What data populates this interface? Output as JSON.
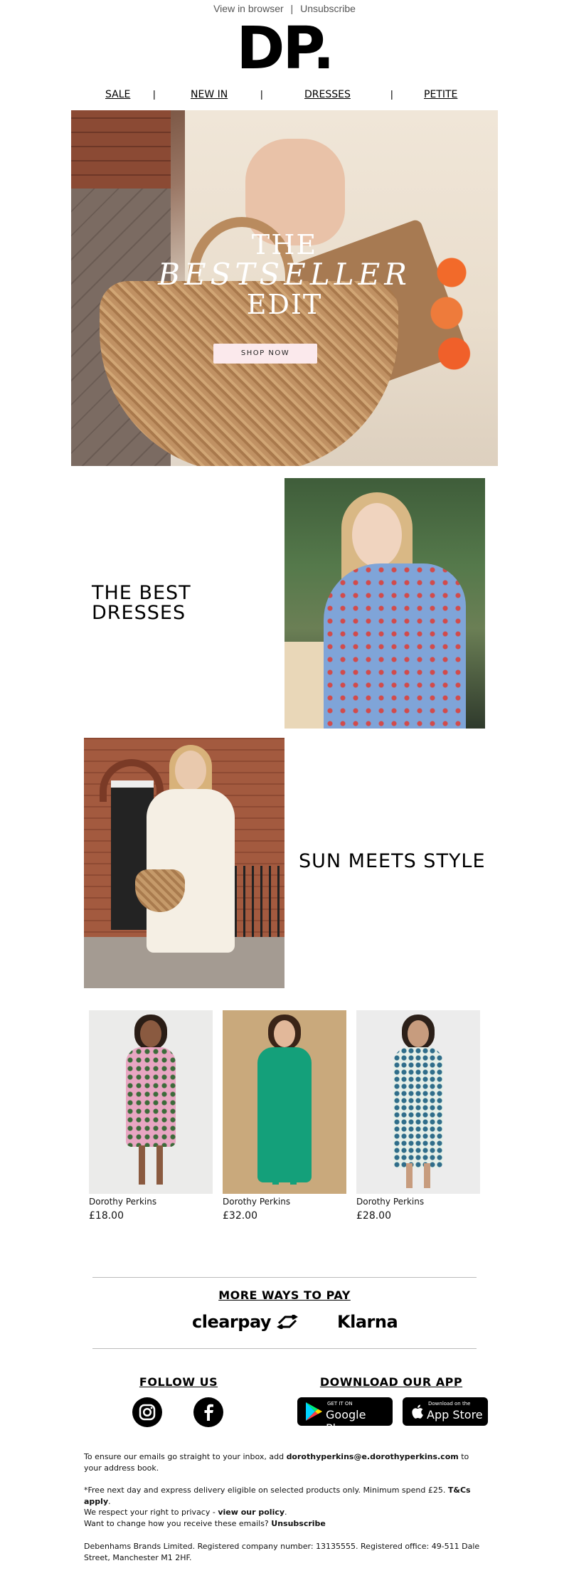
{
  "header": {
    "view_in_browser": "View in browser",
    "separator": "|",
    "unsubscribe": "Unsubscribe",
    "logo": "DP."
  },
  "nav": {
    "items": [
      "SALE",
      "NEW IN",
      "DRESSES",
      "PETITE"
    ],
    "separator": "|"
  },
  "hero": {
    "line1": "THE",
    "line2": "BESTSELLER",
    "line3": "EDIT",
    "cta": "SHOP NOW"
  },
  "features": {
    "block1_title_line1": "THE BEST",
    "block1_title_line2": "DRESSES",
    "block2_title": "SUN MEETS STYLE"
  },
  "products": [
    {
      "brand": "Dorothy Perkins",
      "price": "£18.00"
    },
    {
      "brand": "Dorothy Perkins",
      "price": "£32.00"
    },
    {
      "brand": "Dorothy Perkins",
      "price": "£28.00"
    }
  ],
  "payment": {
    "title": "MORE WAYS TO PAY",
    "clearpay": "clearpay",
    "klarna": "Klarna"
  },
  "follow": {
    "title": "FOLLOW US"
  },
  "app": {
    "title": "DOWNLOAD OUR APP",
    "google_small": "GET IT ON",
    "google_big": "Google Play",
    "apple_small": "Download on the",
    "apple_big": "App Store"
  },
  "legal": {
    "p1_pre": "To ensure our emails go straight to your inbox, add ",
    "p1_email": "dorothyperkins@e.dorothyperkins.com",
    "p1_post": " to your address book.",
    "p2_pre": "*Free next day and express delivery eligible on selected products only. Minimum spend £25. ",
    "p2_link": "T&Cs apply",
    "p2_post": ".",
    "p3_pre": "We respect your right to privacy - ",
    "p3_link": "view our policy",
    "p3_post": ".",
    "p3b_pre": "Want to change how you receive these emails? ",
    "p3b_link": "Unsubscribe",
    "p4": "Debenhams Brands Limited. Registered company number: 13135555. Registered office: 49-511 Dale Street, Manchester M1 2HF."
  },
  "colors": {
    "shop_button_bg": "#fbe9ec",
    "product_green": "#14a07a",
    "text": "#000000"
  }
}
